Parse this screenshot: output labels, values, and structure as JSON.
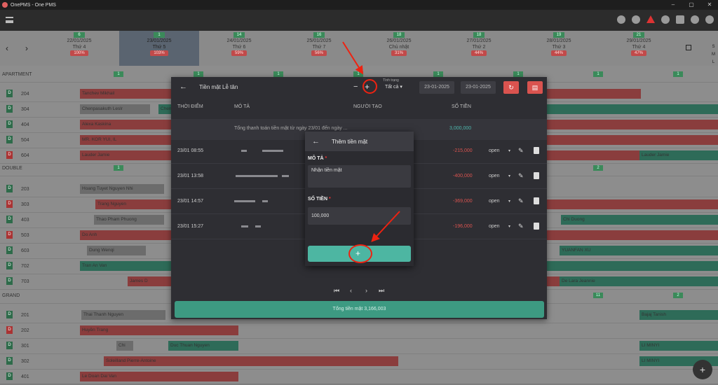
{
  "window": {
    "title": "OnePMS - One PMS"
  },
  "dates": [
    {
      "count": "6",
      "date": "22/01/2025",
      "dow": "Thứ 4",
      "pct": "100%"
    },
    {
      "count": "1",
      "date": "23/01/2025",
      "dow": "Thứ 5",
      "pct": "103%"
    },
    {
      "count": "14",
      "date": "24/01/2025",
      "dow": "Thứ 6",
      "pct": "59%"
    },
    {
      "count": "16",
      "date": "25/01/2025",
      "dow": "Thứ 7",
      "pct": "56%"
    },
    {
      "count": "18",
      "date": "26/01/2025",
      "dow": "Chủ nhật",
      "pct": "31%"
    },
    {
      "count": "18",
      "date": "27/01/2025",
      "dow": "Thứ 2",
      "pct": "44%"
    },
    {
      "count": "19",
      "date": "28/01/2025",
      "dow": "Thứ 3",
      "pct": "44%"
    },
    {
      "count": "21",
      "date": "29/01/2025",
      "dow": "Thứ 4",
      "pct": "47%"
    }
  ],
  "view_modes": [
    "S",
    "M",
    "L"
  ],
  "grid": {
    "sections": [
      {
        "name": "APARTMENT",
        "counts": [
          "1",
          "1",
          "1",
          "1",
          "1",
          "1",
          "1",
          "1"
        ]
      },
      {
        "name": "DOUBLE",
        "counts": [
          "1",
          "2"
        ]
      },
      {
        "name": "GRAND",
        "counts": [
          "11",
          "2"
        ]
      }
    ],
    "rooms": [
      {
        "tag": "D",
        "no": "204",
        "guest": "Tanchev Mikhail"
      },
      {
        "tag": "D",
        "no": "304",
        "guest": "Chenpasakuth Leslr"
      },
      {
        "tag": "D",
        "no": "404",
        "guest": "Alexa Kaskina"
      },
      {
        "tag": "D",
        "no": "504",
        "guest": "MR. KOR YUI, IL"
      },
      {
        "tag": "D",
        "no": "604",
        "guest": "Lauder Jamie",
        "guest2": "Lauder Jamie"
      },
      {
        "tag": "D",
        "no": "203",
        "guest": "Hoang Tuyet Nguyen Nhi"
      },
      {
        "tag": "D",
        "no": "303",
        "guest": "Trang Nguyen"
      },
      {
        "tag": "D",
        "no": "403",
        "guest": "Thao Pham Phuong",
        "guest2": "Chi Duong"
      },
      {
        "tag": "D",
        "no": "503",
        "guest": "Do Anh"
      },
      {
        "tag": "D",
        "no": "603",
        "guest": "Dung Wenqi",
        "guest2": "YUANFAN XU"
      },
      {
        "tag": "D",
        "no": "702",
        "guest": "Tran An Van"
      },
      {
        "tag": "D",
        "no": "703",
        "guest": "James D",
        "guest2": "De Lara Jeannie"
      },
      {
        "tag": "D",
        "no": "201",
        "guest": "Thai Thanh Nguyen",
        "guest2": "Bajaj Tanish"
      },
      {
        "tag": "D",
        "no": "202",
        "guest": "Huyền Trang"
      },
      {
        "tag": "D",
        "no": "301",
        "guest": "Chi",
        "guest3": "Duc Thuan Nguyen",
        "guest2": "LI MINYI"
      },
      {
        "tag": "D",
        "no": "302",
        "guest": "Soleilland Pierre-Antoine",
        "guest2": "LI MINYI"
      },
      {
        "tag": "D",
        "no": "401",
        "guest": "Le Doan Dai Van"
      }
    ]
  },
  "cash_dialog": {
    "title": "Tiền mặt Lễ tân",
    "minus": "−",
    "plus": "+",
    "status_label": "Tình trạng",
    "status_value": "Tất cả",
    "date_from": "23-01-2025",
    "date_to": "23-01-2025",
    "columns": {
      "time": "THỜI ĐIỂM",
      "desc": "MÔ TẢ",
      "creator": "NGƯỜI TẠO",
      "amount": "SỐ TIỀN"
    },
    "summary_text": "Tổng thanh toán tiền mặt từ ngày 23/01 đến ngày ...",
    "summary_amount": "3,000,000",
    "rows": [
      {
        "time": "23/01 08:55",
        "amount": "-215,000",
        "status": "open"
      },
      {
        "time": "23/01 13:58",
        "amount": "-400,000",
        "status": "open"
      },
      {
        "time": "23/01 14:57",
        "amount": "-369,000",
        "status": "open"
      },
      {
        "time": "23/01 15:27",
        "amount": "-196,000",
        "status": "open"
      }
    ],
    "total_label": "Tổng tiền mặt 3,166,003"
  },
  "add_dialog": {
    "title": "Thêm tiền mặt",
    "desc_label": "MÔ TẢ",
    "desc_value": "Nhận tiền mặt",
    "amount_label": "SỐ TIỀN",
    "amount_value": "100,000",
    "add_button": "+"
  },
  "colors": {
    "accent": "#4db6a2",
    "danger": "#d9534f",
    "annotation": "#ee2211"
  }
}
